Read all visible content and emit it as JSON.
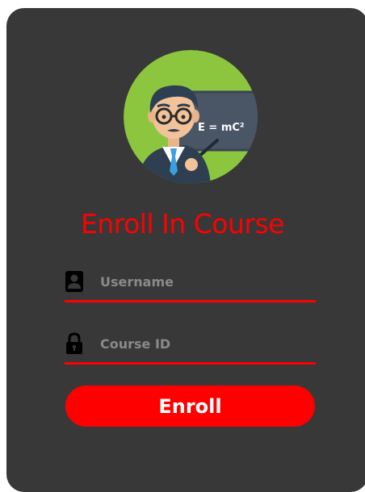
{
  "form": {
    "title": "Enroll In Course",
    "username": {
      "placeholder": "Username",
      "value": ""
    },
    "course_id": {
      "placeholder": "Course ID",
      "value": ""
    },
    "submit_label": "Enroll"
  },
  "avatar": {
    "board_text": "E = mC²",
    "icon": "teacher-avatar"
  },
  "colors": {
    "accent": "#ff0000",
    "card_background": "#383838",
    "placeholder": "#8a8a8a",
    "avatar_background": "#8cc63f",
    "board": "#4a5566"
  }
}
